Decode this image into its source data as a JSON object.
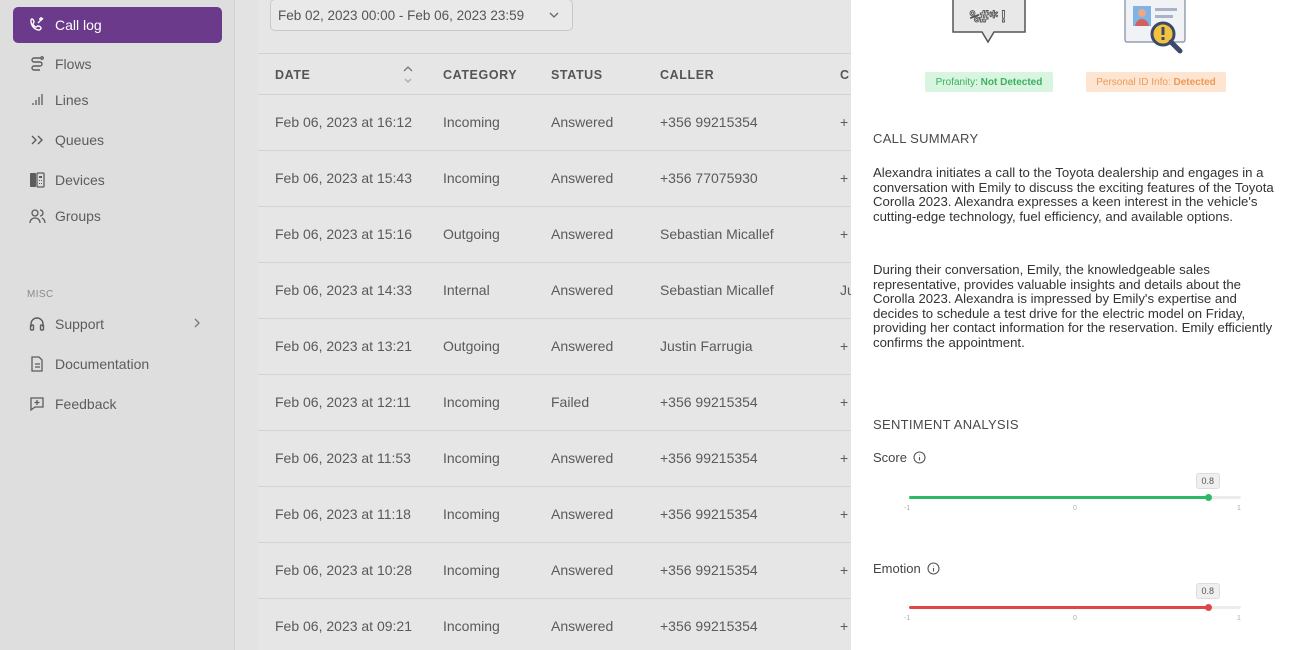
{
  "sidebar": {
    "items": [
      {
        "label": "Call log",
        "icon": "call-log-icon",
        "active": true
      },
      {
        "label": "Flows",
        "icon": "flows-icon"
      },
      {
        "label": "Lines",
        "icon": "lines-icon"
      },
      {
        "label": "Queues",
        "icon": "queues-icon"
      },
      {
        "label": "Devices",
        "icon": "devices-icon"
      },
      {
        "label": "Groups",
        "icon": "groups-icon"
      }
    ],
    "misc_label": "MISC",
    "misc_items": [
      {
        "label": "Support",
        "icon": "headset-icon"
      },
      {
        "label": "Documentation",
        "icon": "document-icon"
      },
      {
        "label": "Feedback",
        "icon": "feedback-icon"
      }
    ]
  },
  "filters": {
    "date_range": "Feb 02, 2023 00:00  -  Feb 06, 2023 23:59"
  },
  "table": {
    "columns": [
      "DATE",
      "CATEGORY",
      "STATUS",
      "CALLER",
      "C"
    ],
    "rows": [
      {
        "date": "Feb 06, 2023 at 16:12",
        "category": "Incoming",
        "status": "Answered",
        "caller": "+356 99215354",
        "extra": "+"
      },
      {
        "date": "Feb 06, 2023 at 15:43",
        "category": "Incoming",
        "status": "Answered",
        "caller": "+356 77075930",
        "extra": "+"
      },
      {
        "date": "Feb 06, 2023 at 15:16",
        "category": "Outgoing",
        "status": "Answered",
        "caller": "Sebastian Micallef",
        "extra": "+"
      },
      {
        "date": "Feb 06, 2023 at 14:33",
        "category": "Internal",
        "status": "Answered",
        "caller": "Sebastian Micallef",
        "extra": "Ju"
      },
      {
        "date": "Feb 06, 2023 at 13:21",
        "category": "Outgoing",
        "status": "Answered",
        "caller": "Justin Farrugia",
        "extra": "+"
      },
      {
        "date": "Feb 06, 2023 at 12:11",
        "category": "Incoming",
        "status": "Failed",
        "caller": "+356 99215354",
        "extra": "+"
      },
      {
        "date": "Feb 06, 2023 at 11:53",
        "category": "Incoming",
        "status": "Answered",
        "caller": "+356 99215354",
        "extra": "+"
      },
      {
        "date": "Feb 06, 2023 at 11:18",
        "category": "Incoming",
        "status": "Answered",
        "caller": "+356 99215354",
        "extra": "+"
      },
      {
        "date": "Feb 06, 2023 at 10:28",
        "category": "Incoming",
        "status": "Answered",
        "caller": "+356 99215354",
        "extra": "+"
      },
      {
        "date": "Feb 06, 2023 at 09:21",
        "category": "Incoming",
        "status": "Answered",
        "caller": "+356 99215354",
        "extra": "+"
      }
    ]
  },
  "panel": {
    "detections": {
      "profanity_prefix": "Profanity: ",
      "profanity_value": "Not Detected",
      "pid_prefix": "Personal ID Info: ",
      "pid_value": "Detected",
      "profanity_symbols": "%#*!"
    },
    "summary_title": "CALL SUMMARY",
    "summary_p1": "Alexandra initiates a call to the Toyota dealership and engages in a conversation with Emily to discuss the exciting features of the Toyota Corolla 2023. Alexandra expresses a keen interest in the vehicle's cutting-edge technology, fuel efficiency, and available options.",
    "summary_p2": "During their conversation, Emily, the knowledgeable sales representative, provides valuable insights and details about the Corolla 2023. Alexandra is impressed by Emily's expertise and decides to schedule a test drive for the electric model on Friday, providing her contact information for the reservation. Emily efficiently confirms the appointment.",
    "sentiment_title": "SENTIMENT ANALYSIS",
    "score": {
      "label": "Score",
      "value": 0.8,
      "value_text": "0.8",
      "min": "-1",
      "mid": "0",
      "max": "1",
      "color": "#2fb865"
    },
    "emotion": {
      "label": "Emotion",
      "value": 0.8,
      "value_text": "0.8",
      "min": "-1",
      "mid": "0",
      "max": "1",
      "color": "#e04848"
    }
  },
  "colors": {
    "accent": "#6b3a8a",
    "success": "#2fb865",
    "danger": "#e04848"
  }
}
